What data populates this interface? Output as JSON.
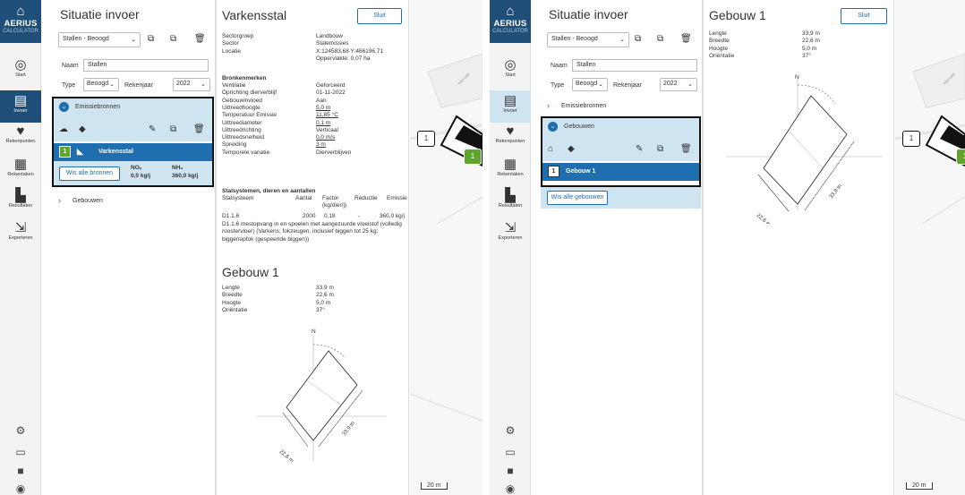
{
  "app": {
    "logo_text": "AERIUS",
    "logo_sub": "CALCULATOR",
    "icons": {
      "logo": "farm-icon"
    }
  },
  "nav": {
    "start": "Start",
    "invoer": "Invoer",
    "rekenpunten": "Rekenpunten",
    "rekentaken": "Rekentaken",
    "resultaten": "Resultaten",
    "exporteren": "Exporteren"
  },
  "situation": {
    "title": "Situatie invoer",
    "select_value": "Stallen - Beoogd",
    "name_label": "Naam",
    "name_value": "Stallen",
    "type_label": "Type",
    "type_value": "Beoogd",
    "year_label": "Rekenjaar",
    "year_value": "2022"
  },
  "emission": {
    "header": "Emissiebronnen",
    "source_num": "1",
    "source_name": "Varkensstal",
    "clear_button": "Wis alle bronnen",
    "nox_label": "NOₓ",
    "nox_value": "0,0 kg/j",
    "nh3_label": "NH₃",
    "nh3_value": "360,0 kg/j",
    "buildings_header": "Gebouwen"
  },
  "detail": {
    "title": "Varkensstal",
    "close": "Sluit",
    "rows": [
      [
        "Sectorgroep",
        "Landbouw"
      ],
      [
        "Sector",
        "Stalemissies"
      ],
      [
        "Locatie",
        "X:124583,68 Y:466196,71"
      ],
      [
        "",
        "Oppervlakte: 0,07 ha"
      ]
    ],
    "kenmerken_title": "Bronkenmerken",
    "kenmerken": [
      [
        "Ventilatie",
        "Geforceerd"
      ],
      [
        "Oprichting dierverblijf",
        "01-11-2022"
      ],
      [
        "Gebouwinvloed",
        "Aan"
      ],
      [
        "Uittreedhoogte",
        "5,0 m"
      ],
      [
        "Temperatuur Emissie",
        "11,85 °C"
      ],
      [
        "Uittreediameter",
        "0,1 m"
      ],
      [
        "Uittreedrichting",
        "Verticaal"
      ],
      [
        "Uittreedsnelheid",
        "0,0 m/s"
      ],
      [
        "Spreiding",
        "3 m"
      ],
      [
        "Temporele variatie",
        "Dierverblijven"
      ]
    ],
    "systems_title": "Stalsystemen, dieren en aantallen",
    "systems_headers": [
      "Stalsysteem",
      "Aantal",
      "Factor (kg/dier/j)",
      "Reductie",
      "Emissie"
    ],
    "system_row": [
      "D1.1.6",
      "2000",
      "0,18",
      "-",
      "360,0 kg/j"
    ],
    "system_desc": "D1.1.6 mestopvang in en spoelen met aangezuurde vloeistof (volledig roostervloer) (Varkens; fokzeugen, inclusief biggen tot 25 kg; biggenopfok (gespeende biggen))"
  },
  "building": {
    "title": "Gebouw 1",
    "rows": [
      [
        "Lengte",
        "33,9 m"
      ],
      [
        "Breedte",
        "22,6 m"
      ],
      [
        "Hoogte",
        "5,0 m"
      ],
      [
        "Oriëntatie",
        "37°"
      ]
    ],
    "north": "N",
    "dim_width": "22,6 m",
    "dim_length": "33,9 m"
  },
  "buildings_panel": {
    "header": "Gebouwen",
    "emission_header": "Emissiebronnen",
    "item_num": "1",
    "item_name": "Gebouw 1",
    "clear_button": "Wis alle gebouwen"
  },
  "map": {
    "scale": "20 m",
    "label_num": "1",
    "label_green": "1",
    "road_label": "Wijersdijk"
  },
  "colors": {
    "primary": "#1f4f79",
    "accent": "#1f6fb0",
    "selected": "#cfe4f1",
    "green": "#5fa52a"
  }
}
